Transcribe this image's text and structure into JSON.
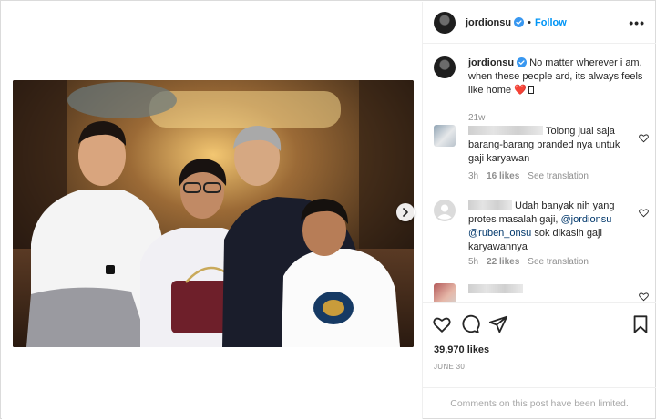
{
  "post": {
    "username": "jordionsu",
    "follow_label": "Follow",
    "more_label": "•••",
    "caption": {
      "username": "jordionsu",
      "text": "No matter wherever i am, when these people ard, its always feels like home",
      "emoji_heart": "❤️",
      "time": "21w"
    },
    "comments": [
      {
        "text": "Tolong jual saja barang-barang branded nya untuk gaji karyawan",
        "time": "3h",
        "likes": "16 likes",
        "translate": "See translation"
      },
      {
        "text_before": "Udah banyak nih yang protes masalah gaji,",
        "mention1": "@jordionsu",
        "mention2": "@ruben_onsu",
        "text_after": "sok dikasih gaji karyawannya",
        "time": "5h",
        "likes": "22 likes",
        "translate": "See translation"
      }
    ],
    "likes_count": "39,970 likes",
    "date": "JUNE 30",
    "comments_limited": "Comments on this post have been limited."
  },
  "colors": {
    "link_blue": "#0095f6",
    "verified_blue": "#3897f0",
    "mention": "#00376b",
    "muted": "#8e8e8e",
    "heart_red": "#e0245e"
  },
  "icons": {
    "header": [
      "verified-icon",
      "more-options-icon"
    ],
    "media": [
      "next-arrow-icon"
    ],
    "actions": [
      "like-icon",
      "comment-icon",
      "share-icon",
      "save-icon"
    ],
    "comment_like": "heart-outline-icon"
  }
}
